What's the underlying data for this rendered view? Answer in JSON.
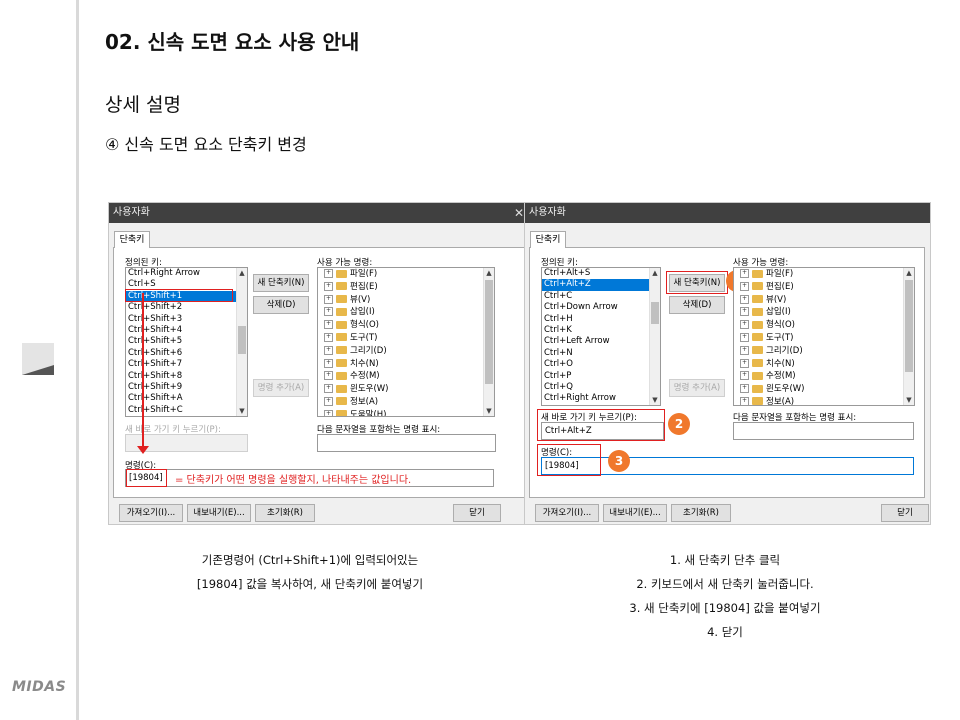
{
  "page": {
    "heading": "02. 신속 도면 요소 사용 안내",
    "subheading": "상세 설명",
    "step": "④ 신속 도면 요소 단축키 변경",
    "logo": "MIDAS"
  },
  "dialog_common": {
    "title": "사용자화",
    "tab": "단축키",
    "defined_keys_label": "정의된 키:",
    "new_shortcut_btn": "새 단축키(N)",
    "delete_btn": "삭제(D)",
    "add_command_btn": "명령 추가(A)",
    "available_commands_label": "사용 가능 명령:",
    "new_shortcut_field_label": "새 바로 가기 키 누르기(P):",
    "filter_label": "다음 문자열을 포함하는 명령 표시:",
    "command_label": "명령(C):",
    "import_btn": "가져오기(I)...",
    "export_btn": "내보내기(E)...",
    "reset_btn": "초기화(R)",
    "close_btn": "닫기",
    "command_groups": [
      "파일(F)",
      "편집(E)",
      "뷰(V)",
      "삽입(I)",
      "형식(O)",
      "도구(T)",
      "그리기(D)",
      "치수(N)",
      "수정(M)",
      "윈도우(W)",
      "정보(A)",
      "도움말(H)"
    ]
  },
  "dialog_left": {
    "keys": [
      "Ctrl+Right Arrow",
      "Ctrl+S",
      "Ctrl+Shift+1",
      "Ctrl+Shift+2",
      "Ctrl+Shift+3",
      "Ctrl+Shift+4",
      "Ctrl+Shift+5",
      "Ctrl+Shift+6",
      "Ctrl+Shift+7",
      "Ctrl+Shift+8",
      "Ctrl+Shift+9",
      "Ctrl+Shift+A",
      "Ctrl+Shift+C"
    ],
    "selected_index": 2,
    "new_shortcut_value": "",
    "command_value": "[19804]",
    "annotation": "= 단축키가 어떤 명령을 실행할지, 나타내주는 값입니다."
  },
  "dialog_right": {
    "keys": [
      "Ctrl+Alt+S",
      "Ctrl+Alt+Z",
      "Ctrl+C",
      "Ctrl+Down Arrow",
      "Ctrl+H",
      "Ctrl+K",
      "Ctrl+Left Arrow",
      "Ctrl+N",
      "Ctrl+O",
      "Ctrl+P",
      "Ctrl+Q",
      "Ctrl+Right Arrow"
    ],
    "selected_index": 1,
    "new_shortcut_value": "Ctrl+Alt+Z",
    "command_value": "[19804]",
    "badges": [
      "1",
      "2",
      "3"
    ]
  },
  "captions": {
    "left": [
      "기존명령어 (Ctrl+Shift+1)에 입력되어있는",
      "[19804] 값을 복사하여, 새 단축키에 붙여넣기"
    ],
    "right": [
      "1. 새 단축키 단추 클릭",
      "2. 키보드에서 새 단축키 눌러줍니다.",
      "3. 새 단축키에  [19804] 값을 붙여넣기",
      "4. 닫기"
    ]
  },
  "colors": {
    "annotation_red": "#e02020",
    "badge_orange": "#f0782c",
    "selection_blue": "#0078d7",
    "titlebar": "#404040"
  }
}
